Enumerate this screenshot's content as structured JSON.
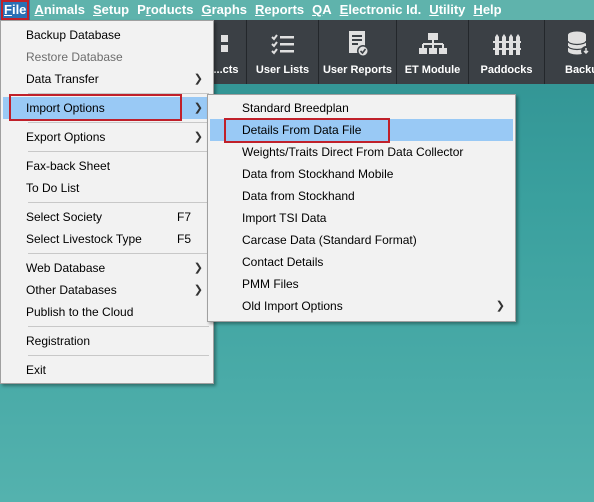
{
  "menubar": {
    "items": [
      {
        "label": "File",
        "accel": "F"
      },
      {
        "label": "Animals",
        "accel": "A"
      },
      {
        "label": "Setup",
        "accel": "S"
      },
      {
        "label": "Products",
        "accel": "r"
      },
      {
        "label": "Graphs",
        "accel": "G"
      },
      {
        "label": "Reports",
        "accel": "R"
      },
      {
        "label": "QA",
        "accel": "Q"
      },
      {
        "label": "Electronic Id.",
        "accel": "E"
      },
      {
        "label": "Utility",
        "accel": "U"
      },
      {
        "label": "Help",
        "accel": "H"
      }
    ]
  },
  "toolbar": {
    "buttons": [
      {
        "label": "...cts",
        "icon": "grid-icon"
      },
      {
        "label": "User Lists",
        "icon": "checklist-icon"
      },
      {
        "label": "User Reports",
        "icon": "report-icon"
      },
      {
        "label": "ET Module",
        "icon": "hierarchy-icon"
      },
      {
        "label": "Paddocks",
        "icon": "fence-icon"
      },
      {
        "label": "Backup",
        "icon": "database-icon"
      }
    ]
  },
  "file_menu": {
    "items": [
      {
        "label": "Backup Database"
      },
      {
        "label": "Restore Database",
        "disabled": true
      },
      {
        "label": "Data Transfer",
        "submenu": true
      },
      {
        "label": "Import Options",
        "submenu": true,
        "highlighted": true
      },
      {
        "label": "Export Options",
        "submenu": true
      },
      {
        "label": "Fax-back Sheet"
      },
      {
        "label": "To Do List"
      },
      {
        "label": "Select Society",
        "shortcut": "F7"
      },
      {
        "label": "Select Livestock Type",
        "shortcut": "F5"
      },
      {
        "label": "Web Database",
        "submenu": true
      },
      {
        "label": "Other Databases",
        "submenu": true
      },
      {
        "label": "Publish to the Cloud"
      },
      {
        "label": "Registration"
      },
      {
        "label": "Exit"
      }
    ]
  },
  "import_menu": {
    "items": [
      {
        "label": "Standard Breedplan"
      },
      {
        "label": "Details From Data File",
        "highlighted": true
      },
      {
        "label": "Weights/Traits Direct From Data Collector"
      },
      {
        "label": "Data from Stockhand Mobile"
      },
      {
        "label": "Data from Stockhand"
      },
      {
        "label": "Import TSI Data"
      },
      {
        "label": "Carcase Data (Standard Format)"
      },
      {
        "label": "Contact Details"
      },
      {
        "label": "PMM Files"
      },
      {
        "label": "Old Import Options",
        "submenu": true
      }
    ]
  },
  "colors": {
    "menubar_bg": "#5fb3ac",
    "toolbar_bg": "#3b4045",
    "highlight": "#99c9f5",
    "annotation_red": "#c0202a"
  }
}
